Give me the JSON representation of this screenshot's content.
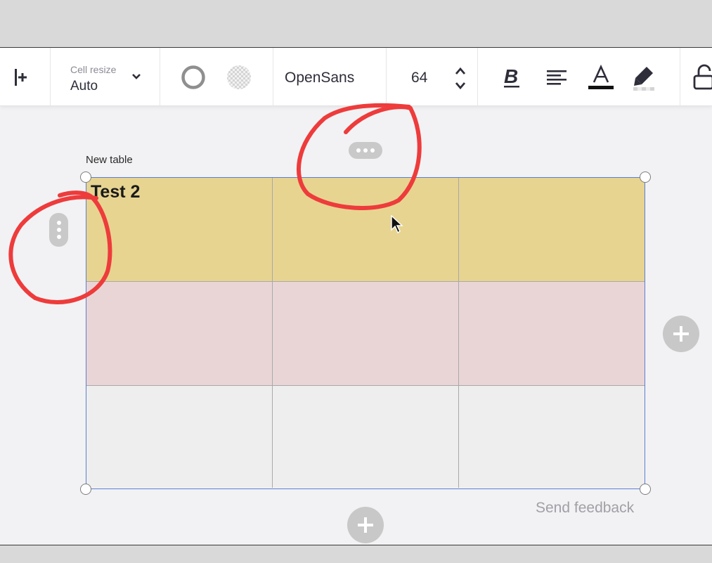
{
  "toolbar": {
    "cell_resize_label": "Cell resize",
    "cell_resize_value": "Auto",
    "font_name": "OpenSans",
    "font_size": "64"
  },
  "canvas": {
    "table_title": "New table",
    "cells": [
      [
        "Test 2",
        "",
        ""
      ],
      [
        "",
        "",
        ""
      ],
      [
        "",
        "",
        ""
      ]
    ],
    "row_colors": [
      "#e7d491",
      "#ead5d6",
      "#eeeeee"
    ],
    "send_feedback": "Send feedback"
  },
  "colors": {
    "selection": "#5b7fd1",
    "annotation": "#ee3b3b"
  },
  "icons": {
    "toolbar": [
      "insert-column-icon",
      "chevron-down-icon",
      "border-ring-icon",
      "transparency-icon",
      "stepper-up-icon",
      "stepper-down-icon",
      "bold-icon",
      "align-left-icon",
      "text-color-icon",
      "highlight-pen-icon",
      "unlock-icon"
    ],
    "canvas": [
      "more-horizontal-icon",
      "more-vertical-icon",
      "plus-icon",
      "mouse-cursor-icon"
    ]
  }
}
